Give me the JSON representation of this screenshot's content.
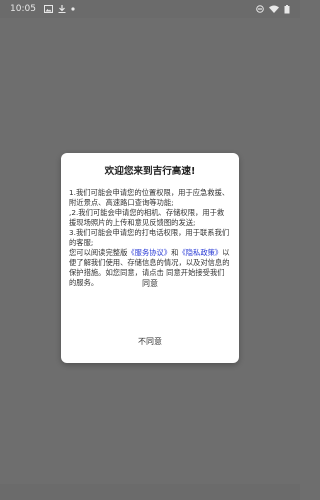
{
  "status_bar": {
    "time": "10:05",
    "left_icons": [
      "image-icon",
      "download-icon",
      "notification-dot-icon"
    ],
    "right_icons": [
      "do-not-disturb-icon",
      "wifi-icon",
      "battery-icon"
    ]
  },
  "colors": {
    "overlay": "#6e6e6e",
    "dialog_bg": "#ffffff",
    "link": "#2a3bd6",
    "logo": "#1a8a78"
  },
  "dialog": {
    "title": "欢迎您来到吉行高速!",
    "p1": "1.我们可能会申请您的位置权限，用于应急救援、附近景点、高速路口查询等功能;",
    "p2": ",2.我们可能会申请您的相机、存储权限，用于救援现场照片的上传和意见反馈图的发送;",
    "p3": "3.我们可能会申请您的打电话权限，用于联系我们的客服;",
    "p4_prefix": "您可以阅读完整版",
    "service_link": "《服务协议》",
    "and": "和",
    "privacy_link": "《隐私政策》",
    "p4_suffix": "以便了解我们使用、存储信息的情况，以及对信息的保护措施。如您同意，请点击 同意开始接受我们的服务。",
    "agree_label": "同意",
    "disagree_label": "不同意"
  }
}
